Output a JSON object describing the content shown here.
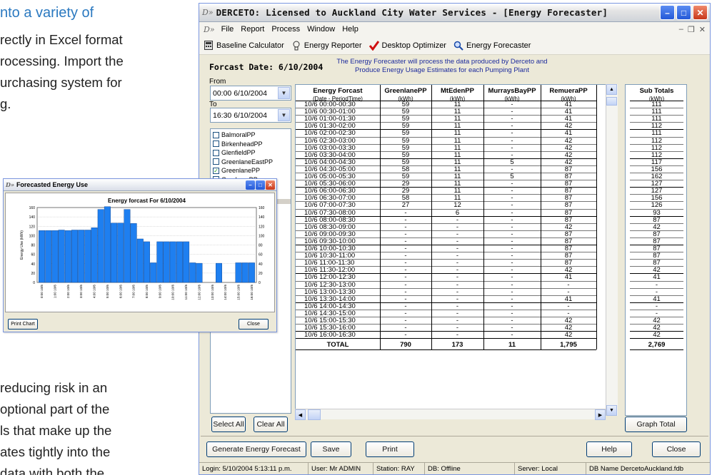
{
  "background_doc": {
    "top_lines": [
      "nto a variety of",
      "rectly in Excel format",
      "rocessing. Import the",
      "urchasing system for",
      "g."
    ],
    "bottom_lines": [
      "reducing risk in an",
      "optional part of the",
      "ls that make up the",
      "ates tightly into the",
      "data with both the"
    ]
  },
  "main": {
    "logo": "D»",
    "title": "DERCETO:  Licensed to Auckland City Water Services - [Energy Forecaster]",
    "menu": [
      "File",
      "Report",
      "Process",
      "Window",
      "Help"
    ],
    "toolbar": [
      "Baseline Calculator",
      "Energy Reporter",
      "Desktop Optimizer",
      "Energy Forecaster"
    ],
    "forecast_date_label": "Forcast Date:  6/10/2004",
    "info_line1": "The Energy Forecaster will process the data produced by Derceto and",
    "info_line2": "Produce Energy Usage Estimates for each Pumping Plant",
    "from_label": "From",
    "from_value": "00:00 6/10/2004",
    "to_label": "To",
    "to_value": "16:30 6/10/2004",
    "plants": [
      {
        "name": "BalmoralPP",
        "checked": false
      },
      {
        "name": "BirkenheadPP",
        "checked": false
      },
      {
        "name": "GlenfieldPP",
        "checked": false
      },
      {
        "name": "GreenlaneEastPP",
        "checked": false
      },
      {
        "name": "GreenlanePP",
        "checked": true
      },
      {
        "name": "GreyLynnPP",
        "checked": false
      }
    ],
    "select_all": "Select All",
    "clear_all": "Clear All",
    "graph_total": "Graph Total",
    "generate": "Generate Energy Forecast",
    "save": "Save",
    "print": "Print",
    "help": "Help",
    "close": "Close",
    "status": [
      "Login: 5/10/2004 5:13:11 p.m.",
      "User: Mr ADMIN",
      "Station: RAY",
      "DB: Offline",
      "Server: Local",
      "DB Name DercetoAuckland.fdb"
    ]
  },
  "table": {
    "headers": [
      "Energy Forcast",
      "GreenlanePP",
      "MtEdenPP",
      "MurraysBayPP",
      "RemueraPP"
    ],
    "subheaders": [
      "(Date - PeriodTime)",
      "(kWh)",
      "(kWh)",
      "(kWh)",
      "(kWh)"
    ],
    "rows": [
      [
        "10/6  00:00-00:30",
        "59",
        "11",
        "-",
        "41"
      ],
      [
        "10/6  00:30-01:00",
        "59",
        "11",
        "-",
        "41"
      ],
      [
        "10/6  01:00-01:30",
        "59",
        "11",
        "-",
        "41"
      ],
      [
        "10/6  01:30-02:00",
        "59",
        "11",
        "-",
        "42"
      ],
      [
        "10/6  02:00-02:30",
        "59",
        "11",
        "-",
        "41"
      ],
      [
        "10/6  02:30-03:00",
        "59",
        "11",
        "-",
        "42"
      ],
      [
        "10/6  03:00-03:30",
        "59",
        "11",
        "-",
        "42"
      ],
      [
        "10/6  03:30-04:00",
        "59",
        "11",
        "-",
        "42"
      ],
      [
        "10/6  04:00-04:30",
        "59",
        "11",
        "5",
        "42"
      ],
      [
        "10/6  04:30-05:00",
        "58",
        "11",
        "-",
        "87"
      ],
      [
        "10/6  05:00-05:30",
        "59",
        "11",
        "5",
        "87"
      ],
      [
        "10/6  05:30-06:00",
        "29",
        "11",
        "-",
        "87"
      ],
      [
        "10/6  06:00-06:30",
        "29",
        "11",
        "-",
        "87"
      ],
      [
        "10/6  06:30-07:00",
        "58",
        "11",
        "-",
        "87"
      ],
      [
        "10/6  07:00-07:30",
        "27",
        "12",
        "-",
        "87"
      ],
      [
        "10/6  07:30-08:00",
        "-",
        "6",
        "-",
        "87"
      ],
      [
        "10/6  08:00-08:30",
        "-",
        "-",
        "-",
        "87"
      ],
      [
        "10/6  08:30-09:00",
        "-",
        "-",
        "-",
        "42"
      ],
      [
        "10/6  09:00-09:30",
        "-",
        "-",
        "-",
        "87"
      ],
      [
        "10/6  09:30-10:00",
        "-",
        "-",
        "-",
        "87"
      ],
      [
        "10/6  10:00-10:30",
        "-",
        "-",
        "-",
        "87"
      ],
      [
        "10/6  10:30-11:00",
        "-",
        "-",
        "-",
        "87"
      ],
      [
        "10/6  11:00-11:30",
        "-",
        "-",
        "-",
        "87"
      ],
      [
        "10/6  11:30-12:00",
        "-",
        "-",
        "-",
        "42"
      ],
      [
        "10/6  12:00-12:30",
        "-",
        "-",
        "-",
        "41"
      ],
      [
        "10/6  12:30-13:00",
        "-",
        "-",
        "-",
        "-"
      ],
      [
        "10/6  13:00-13:30",
        "-",
        "-",
        "-",
        "-"
      ],
      [
        "10/6  13:30-14:00",
        "-",
        "-",
        "-",
        "41"
      ],
      [
        "10/6  14:00-14:30",
        "-",
        "-",
        "-",
        "-"
      ],
      [
        "10/6  14:30-15:00",
        "-",
        "-",
        "-",
        "-"
      ],
      [
        "10/6  15:00-15:30",
        "-",
        "-",
        "-",
        "42"
      ],
      [
        "10/6  15:30-16:00",
        "-",
        "-",
        "-",
        "42"
      ],
      [
        "10/6  16:00-16:30",
        "-",
        "-",
        "-",
        "42"
      ]
    ],
    "total": [
      "TOTAL",
      "790",
      "173",
      "11",
      "1,795"
    ]
  },
  "subtotals": {
    "header": "Sub Totals",
    "subheader": "(kWh)",
    "values": [
      "111",
      "111",
      "111",
      "112",
      "111",
      "112",
      "112",
      "112",
      "117",
      "156",
      "162",
      "127",
      "127",
      "156",
      "126",
      "93",
      "87",
      "42",
      "87",
      "87",
      "87",
      "87",
      "87",
      "42",
      "41",
      "-",
      "-",
      "41",
      "-",
      "-",
      "42",
      "42",
      "42"
    ],
    "total": "2,769"
  },
  "chart_window": {
    "title": "Forecasted Energy Use",
    "print_chart": "Print Chart",
    "close": "Close"
  },
  "chart_data": {
    "type": "bar",
    "title": "Energy forcast For 6/10/2004",
    "ylabel": "Energy Use (kWh)",
    "ylim": [
      0,
      160
    ],
    "yticks": [
      0,
      20,
      40,
      60,
      80,
      100,
      120,
      140,
      160
    ],
    "grid": true,
    "color": "#1e7ff0",
    "categories": [
      "0:00 10/6",
      "0:30 10/6",
      "1:00 10/6",
      "1:30 10/6",
      "2:00 10/6",
      "2:30 10/6",
      "3:00 10/6",
      "3:30 10/6",
      "4:00 10/6",
      "4:30 10/6",
      "5:00 10/6",
      "5:30 10/6",
      "6:00 10/6",
      "6:30 10/6",
      "7:00 10/6",
      "7:30 10/6",
      "8:00 10/6",
      "8:30 10/6",
      "9:00 10/6",
      "9:30 10/6",
      "10:00 10/6",
      "10:30 10/6",
      "11:00 10/6",
      "11:30 10/6",
      "12:00 10/6",
      "12:30 10/6",
      "13:00 10/6",
      "13:30 10/6",
      "14:00 10/6",
      "14:30 10/6",
      "15:00 10/6",
      "15:30 10/6",
      "16:00 10/6"
    ],
    "values": [
      111,
      111,
      111,
      112,
      111,
      112,
      112,
      112,
      117,
      156,
      162,
      127,
      127,
      156,
      126,
      93,
      87,
      42,
      87,
      87,
      87,
      87,
      87,
      42,
      41,
      0,
      0,
      41,
      0,
      0,
      42,
      42,
      42
    ],
    "xtick_labels": [
      "0:00 10/6",
      "1:00 10/6",
      "2:00 10/6",
      "3:00 10/6",
      "4:00 10/6",
      "5:00 10/6",
      "6:00 10/6",
      "7:00 10/6",
      "8:00 10/6",
      "9:00 10/6",
      "10:00 10/6",
      "11:00 10/6",
      "12:00 10/6",
      "13:00 10/6",
      "14:00 10/6",
      "15:00 10/6",
      "16:00 10/6"
    ]
  }
}
